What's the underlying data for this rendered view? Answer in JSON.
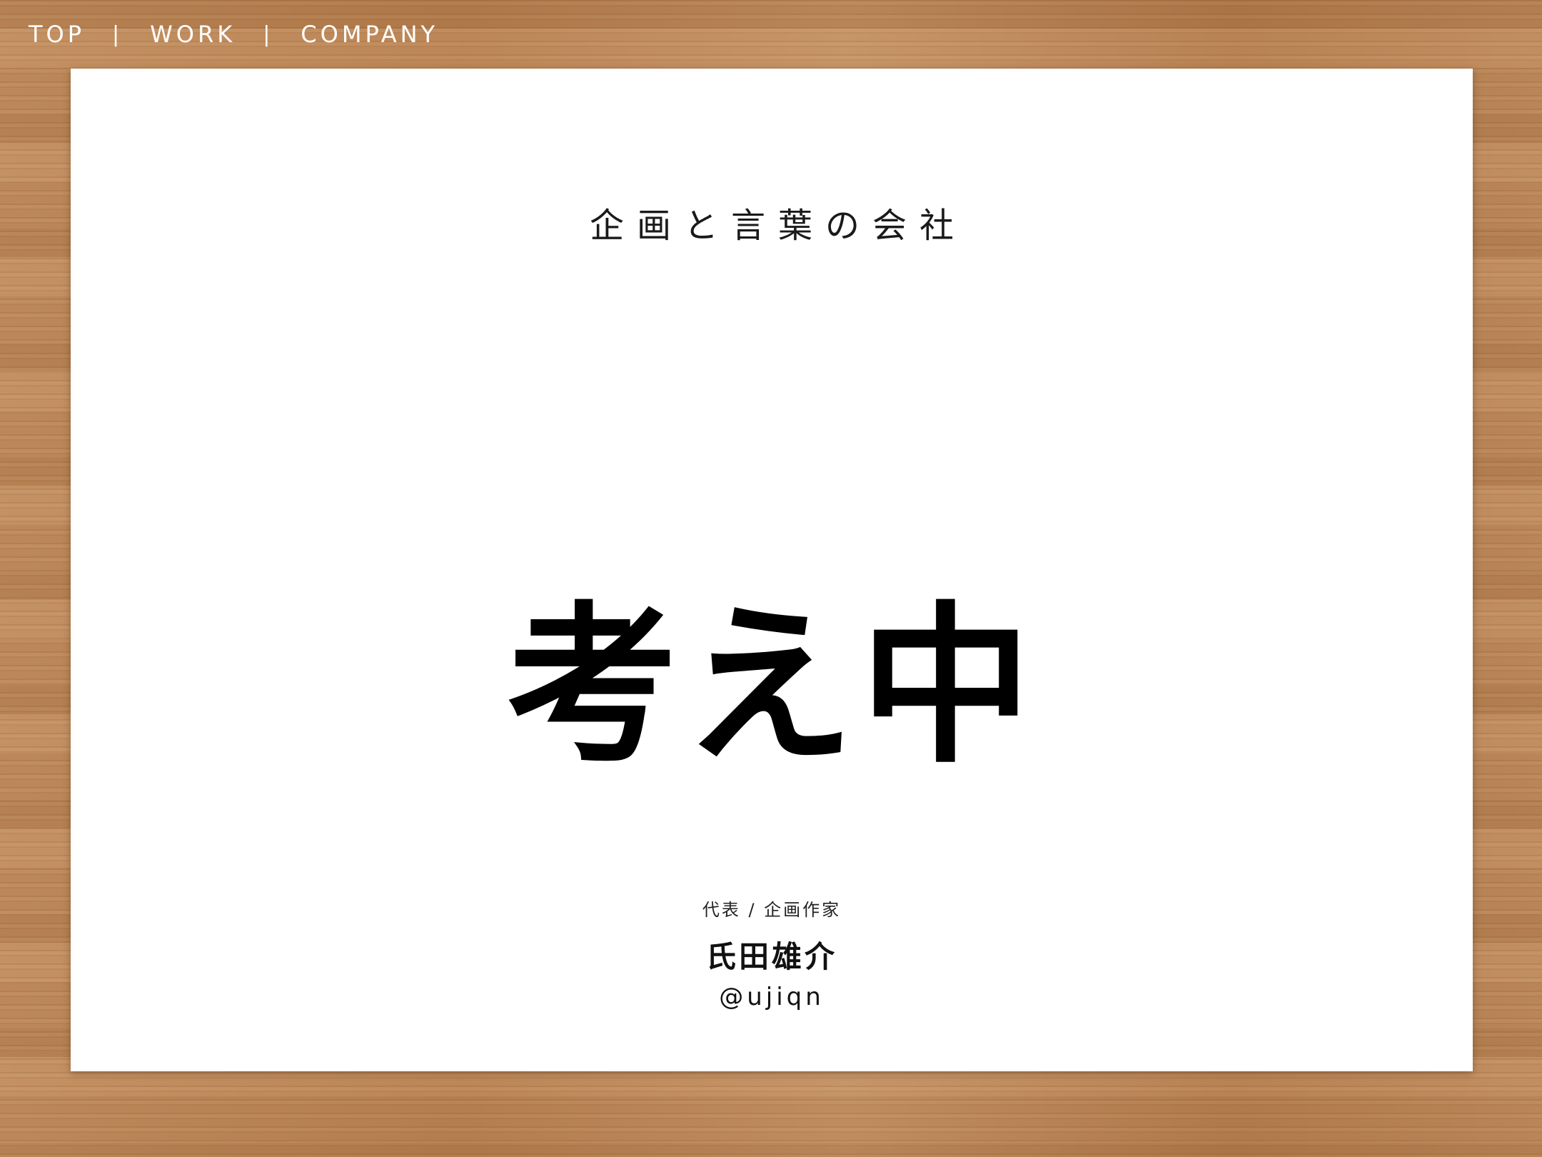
{
  "nav": {
    "items": [
      {
        "label": "TOP"
      },
      {
        "label": "WORK"
      },
      {
        "label": "COMPANY"
      }
    ],
    "separator": "|",
    "text_color": "#ffffff"
  },
  "card": {
    "tagline": "企画と言葉の会社",
    "hero": "考え中",
    "role": "代表 / 企画作家",
    "name": "氏田雄介",
    "handle": "@ujiqn"
  },
  "colors": {
    "background_wood": "#b98654",
    "card": "#ffffff",
    "text": "#000000"
  }
}
